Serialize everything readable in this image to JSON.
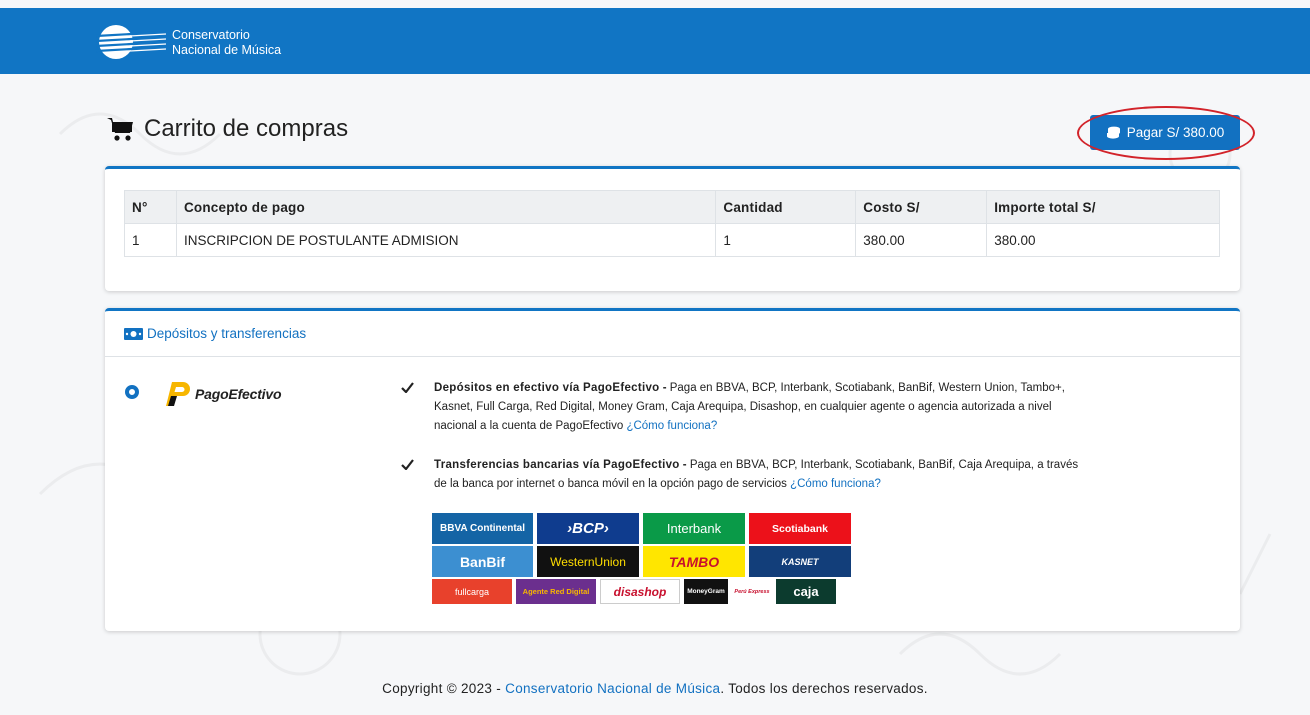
{
  "header": {
    "logo_line1": "Conservatorio",
    "logo_line2": "Nacional de Música",
    "color": "#1175c4"
  },
  "page": {
    "title": "Carrito de compras",
    "pay_button_label": "Pagar S/ 380.00"
  },
  "cart_table": {
    "headers": [
      "N°",
      "Concepto de pago",
      "Cantidad",
      "Costo S/",
      "Importe total S/"
    ],
    "rows": [
      [
        "1",
        "INSCRIPCION DE POSTULANTE ADMISION",
        "1",
        "380.00",
        "380.00"
      ]
    ]
  },
  "payment": {
    "section_title": "Depósitos y transferencias",
    "method_name": "PagoEfectivo",
    "features": [
      {
        "title": "Depósitos en efectivo vía PagoEfectivo",
        "separator": " - ",
        "text": "Paga en BBVA, BCP, Interbank, Scotiabank, BanBif, Western Union, Tambo+, Kasnet, Full Carga, Red Digital, Money Gram, Caja Arequipa, Disashop, en cualquier agente o agencia autorizada a nivel nacional a la cuenta de PagoEfectivo ",
        "link": "¿Cómo funciona?"
      },
      {
        "title": "Transferencias bancarias vía PagoEfectivo",
        "separator": " - ",
        "text": "Paga en BBVA, BCP, Interbank, Scotiabank, BanBif, Caja Arequipa, a través de la banca por internet o banca móvil en la opción pago de servicios ",
        "link": "¿Cómo funciona?"
      }
    ],
    "banks": [
      [
        {
          "label": "BBVA Continental",
          "color": "#1464a5"
        },
        {
          "label": "›BCP›",
          "color": "#0f3c8e"
        },
        {
          "label": "Interbank",
          "color": "#0a9a48"
        },
        {
          "label": "Scotiabank",
          "color": "#ec111a"
        }
      ],
      [
        {
          "label": "BanBif",
          "color": "#3c8fd1"
        },
        {
          "label": "WesternUnion",
          "color": "#111111"
        },
        {
          "label": "TAMBO",
          "color": "#ffe600"
        },
        {
          "label": "KASNET",
          "color": "#123e7a"
        }
      ],
      [
        {
          "label": "fullcarga",
          "color": "#e8412c"
        },
        {
          "label": "Agente Red Digital",
          "color": "#6b2f8e"
        },
        {
          "label": "disashop",
          "color": "#ffffff"
        },
        {
          "label": "MoneyGram",
          "color": "#111111"
        },
        {
          "label": "Perú Express",
          "color": "#ffffff"
        },
        {
          "label": "caja",
          "color": "#0c3b2e"
        }
      ]
    ]
  },
  "footer": {
    "prefix": "Copyright © 2023 - ",
    "link": "Conservatorio Nacional de Música",
    "suffix": ". Todos los derechos reservados."
  }
}
